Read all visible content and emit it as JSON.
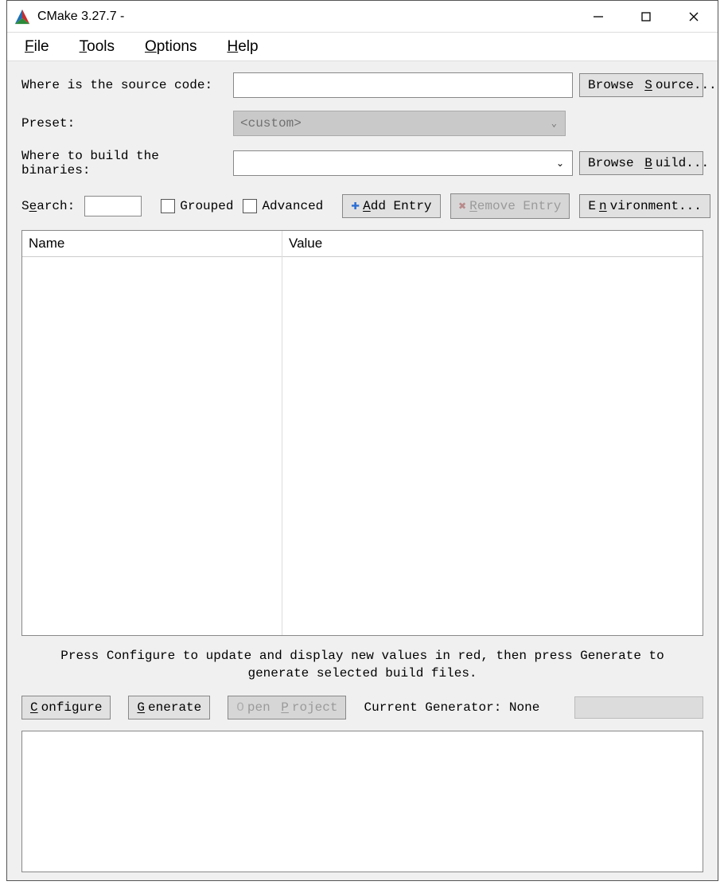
{
  "title": "CMake 3.27.7 -",
  "menu": {
    "file": "File",
    "tools": "Tools",
    "options": "Options",
    "help": "Help"
  },
  "labels": {
    "source": "Where is the source code:",
    "preset": "Preset:",
    "build": "Where to build the binaries:",
    "search": "Search:",
    "grouped": "Grouped",
    "advanced": "Advanced"
  },
  "buttons": {
    "browse_source": "Browse Source...",
    "browse_build": "Browse Build...",
    "add_entry": "Add Entry",
    "remove_entry": "Remove Entry",
    "environment": "Environment...",
    "configure": "Configure",
    "generate": "Generate",
    "open_project": "Open Project"
  },
  "preset_value": "<custom>",
  "source_value": "",
  "build_value": "",
  "search_value": "",
  "table": {
    "headers": {
      "name": "Name",
      "value": "Value"
    },
    "rows": []
  },
  "hint": "Press Configure to update and display new values in red, then press Generate to generate selected build files.",
  "status": "Current Generator: None"
}
